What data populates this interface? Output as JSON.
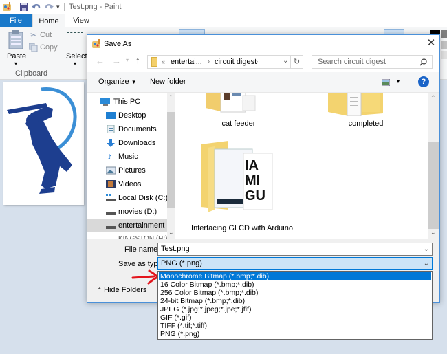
{
  "paint": {
    "window_title": "Test.png - Paint",
    "tabs": [
      {
        "label": "File",
        "active": false,
        "accent": true
      },
      {
        "label": "Home",
        "active": true
      },
      {
        "label": "View",
        "active": false
      }
    ],
    "clipboard": {
      "paste_label": "Paste",
      "cut_label": "Cut",
      "copy_label": "Copy",
      "group_label": "Clipboard"
    },
    "image": {
      "select_label": "Select"
    },
    "colors": {
      "file_tab": "#1979ca",
      "primary": "#000000"
    }
  },
  "dialog": {
    "title": "Save As",
    "breadcrumb": {
      "overflow": "«",
      "items": [
        "entertai...",
        "circuit digest"
      ]
    },
    "search_placeholder": "Search circuit digest",
    "toolbar": {
      "organize_label": "Organize",
      "new_folder_label": "New folder"
    },
    "nav_items": [
      {
        "label": "This PC",
        "icon": "computer-icon",
        "level": 0
      },
      {
        "label": "Desktop",
        "icon": "desktop-icon",
        "level": 1
      },
      {
        "label": "Documents",
        "icon": "documents-icon",
        "level": 1
      },
      {
        "label": "Downloads",
        "icon": "downloads-icon",
        "level": 1
      },
      {
        "label": "Music",
        "icon": "music-icon",
        "level": 1
      },
      {
        "label": "Pictures",
        "icon": "pictures-icon",
        "level": 1
      },
      {
        "label": "Videos",
        "icon": "videos-icon",
        "level": 1
      },
      {
        "label": "Local Disk (C:)",
        "icon": "local-disk-icon",
        "level": 1
      },
      {
        "label": "movies (D:)",
        "icon": "drive-icon",
        "level": 1
      },
      {
        "label": "entertainment (F",
        "icon": "drive-icon",
        "level": 1,
        "selected": true
      },
      {
        "label": "KINGSTON (H:)",
        "icon": "drive-icon",
        "level": 1
      }
    ],
    "files": [
      {
        "name": "cat feeder"
      },
      {
        "name": "completed"
      },
      {
        "name": "Interfacing GLCD with Arduino"
      }
    ],
    "file_name_label": "File name:",
    "file_name_value": "Test.png",
    "save_type_label": "Save as type:",
    "save_type_value": "PNG (*.png)",
    "save_type_options": [
      "Monochrome Bitmap (*.bmp;*.dib)",
      "16 Color Bitmap (*.bmp;*.dib)",
      "256 Color Bitmap (*.bmp;*.dib)",
      "24-bit Bitmap (*.bmp;*.dib)",
      "JPEG (*.jpg;*.jpeg;*.jpe;*.jfif)",
      "GIF (*.gif)",
      "TIFF (*.tif;*.tiff)",
      "PNG (*.png)"
    ],
    "highlighted_option_index": 0,
    "hide_folders_label": "Hide Folders",
    "help_glyph": "?",
    "colors": {
      "accent": "#0078d7",
      "help": "#1a64c8",
      "annotation_arrow": "#e3141b"
    }
  }
}
